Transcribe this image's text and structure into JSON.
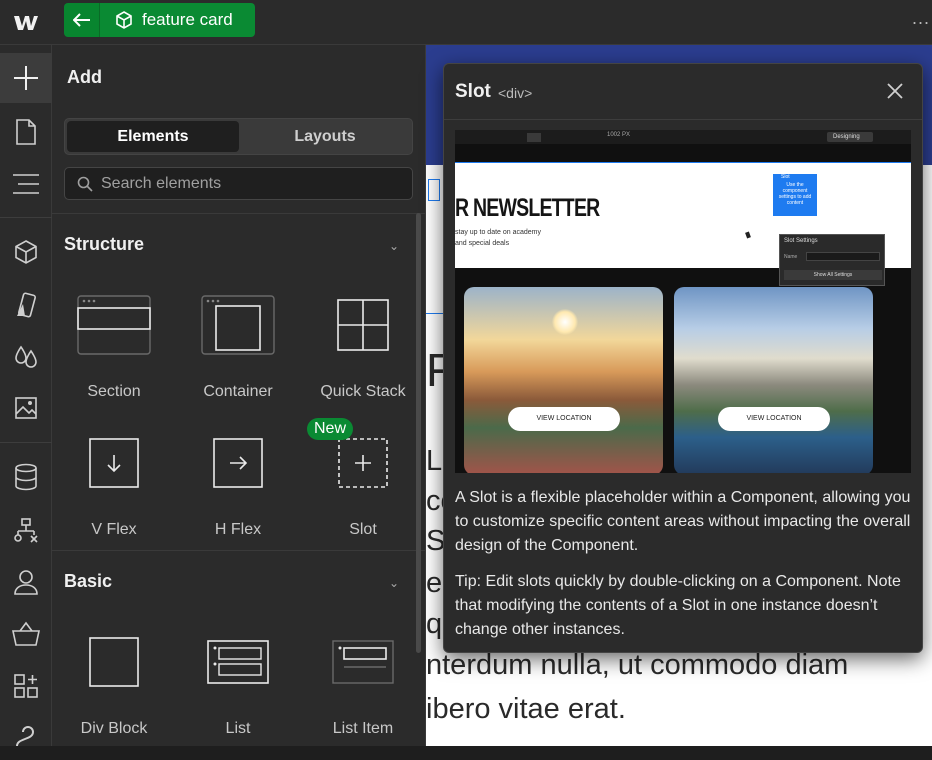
{
  "topbar": {
    "component_name": "feature card",
    "more_label": "..."
  },
  "panel": {
    "title": "Add",
    "tabs": [
      "Elements",
      "Layouts"
    ],
    "search_placeholder": "Search elements",
    "structure": {
      "title": "Structure",
      "items": [
        "Section",
        "Container",
        "Quick Stack",
        "V Flex",
        "H Flex",
        "Slot"
      ],
      "new_badge": "New"
    },
    "basic": {
      "title": "Basic",
      "items": [
        "Div Block",
        "List",
        "List Item"
      ]
    }
  },
  "canvas": {
    "lines": [
      "F",
      "Lo",
      "co",
      "Su",
      "el",
      "qu",
      "nterdum nulla, ut commodo diam",
      "ibero vitae erat."
    ]
  },
  "popup": {
    "title": "Slot",
    "tag": "<div>",
    "description": "A Slot is a flexible placeholder within a Component, allowing you to customize specific content areas without impacting the overall design of the Component.",
    "tip": "Tip: Edit slots quickly by double-clicking on a Component. Note that modifying the contents of a Slot in one instance doesn’t change other instances.",
    "preview": {
      "zoom": "1002 PX",
      "mode": "Designing",
      "heading": "R NEWSLETTER",
      "sub1": "stay up to date on academy",
      "sub2": "and special deals",
      "slot_chip": "Slot",
      "slot_box_text": "Use the component settings to add content",
      "settings_title": "Slot Settings",
      "settings_field": "Name",
      "settings_btn": "Show All Settings",
      "card_btn": "VIEW LOCATION"
    }
  },
  "colors": {
    "accent_green": "#0a8a33",
    "panel_bg": "#2b2b2b",
    "canvas_band": "#2b3d8f",
    "slot_blue": "#1e7bf0"
  }
}
